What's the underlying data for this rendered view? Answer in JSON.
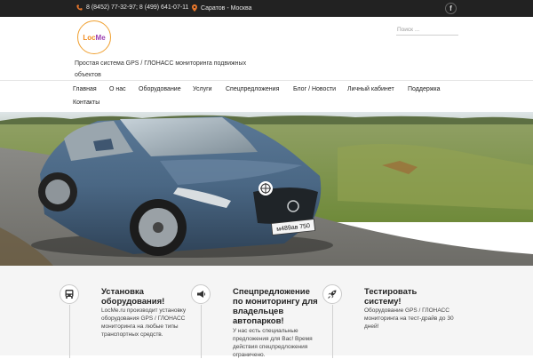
{
  "topbar": {
    "phone": "8 (8452) 77-32-97; 8 (499) 641-07-11",
    "city": "Саратов - Москва",
    "facebook_glyph": "f",
    "accent_color": "#e8762b"
  },
  "header": {
    "logo_part1": "Loc",
    "logo_part2": "Me",
    "tagline": "Простая система GPS / ГЛОНАСС мониторинга подвижных объектов",
    "search_placeholder": "Поиск ..."
  },
  "nav": {
    "items": [
      {
        "label": "Главная"
      },
      {
        "label": "О нас"
      },
      {
        "label": "Оборудование"
      },
      {
        "label": "Услуги"
      },
      {
        "label": "Спецпредложения"
      },
      {
        "label": "Блог / Новости"
      },
      {
        "label": "Личный кабинет"
      },
      {
        "label": "Поддержка"
      },
      {
        "label": "Контакты"
      }
    ]
  },
  "hero": {
    "plate": "м489ав 750"
  },
  "features": [
    {
      "icon": "bus-icon",
      "title": "Установка оборудования!",
      "text": "LocMe.ru производит установку оборудования GPS / ГЛОНАСС мониторинга на любые типы транспортных средств."
    },
    {
      "icon": "megaphone-icon",
      "title": "Спецпредложение по мониторингу для владельцев автопарков!",
      "text": "У нас есть специальные предложения для Вас! Время действия спецпредложения ограничено."
    },
    {
      "icon": "rocket-icon",
      "title": "Тестировать систему!",
      "text": "Оборудование GPS / ГЛОНАСС мониторинга на тест-драйв до 30 дней!"
    }
  ]
}
